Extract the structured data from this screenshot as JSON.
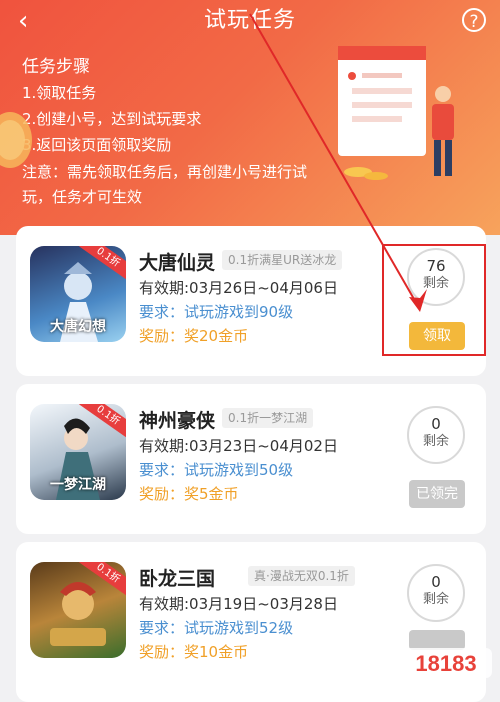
{
  "header": {
    "title": "试玩任务",
    "back_glyph": "‹",
    "help_glyph": "?",
    "steps_title": "任务步骤",
    "steps": [
      "1.领取任务",
      "2.创建小号，达到试玩要求",
      "3.返回该页面领取奖励"
    ],
    "note": "注意：需先领取任务后，再创建小号进行试玩，任务才可生效"
  },
  "cards": [
    {
      "name": "大唐仙灵",
      "promo": "0.1折满星UR送冰龙",
      "validity": "有效期:03月26日~04月06日",
      "req_label": "要求：",
      "req_value": "试玩游戏到90级",
      "reward_label": "奖励：",
      "reward_value": "奖20金币",
      "remaining": "76",
      "remaining_label": "剩余",
      "button": "领取",
      "icon_tag": "0.1折",
      "icon_caption": "大唐幻想"
    },
    {
      "name": "神州豪侠",
      "promo": "0.1折一梦江湖",
      "validity": "有效期:03月23日~04月02日",
      "req_label": "要求：",
      "req_value": "试玩游戏到50级",
      "reward_label": "奖励：",
      "reward_value": "奖5金币",
      "remaining": "0",
      "remaining_label": "剩余",
      "button": "已领完",
      "icon_tag": "0.1折",
      "icon_caption": "一梦江湖"
    },
    {
      "name": "卧龙三国",
      "promo": "真·漫战无双0.1折",
      "validity": "有效期:03月19日~03月28日",
      "req_label": "要求：",
      "req_value": "试玩游戏到52级",
      "reward_label": "奖励：",
      "reward_value": "奖10金币",
      "remaining": "0",
      "remaining_label": "剩余",
      "button": "",
      "icon_tag": "0.1折",
      "icon_caption": ""
    }
  ],
  "watermark": "18183",
  "colors": {
    "header_start": "#f0533e",
    "header_end": "#f7a35c",
    "claim": "#f3b83b",
    "done": "#c9c9c9",
    "highlight": "#e02828"
  }
}
